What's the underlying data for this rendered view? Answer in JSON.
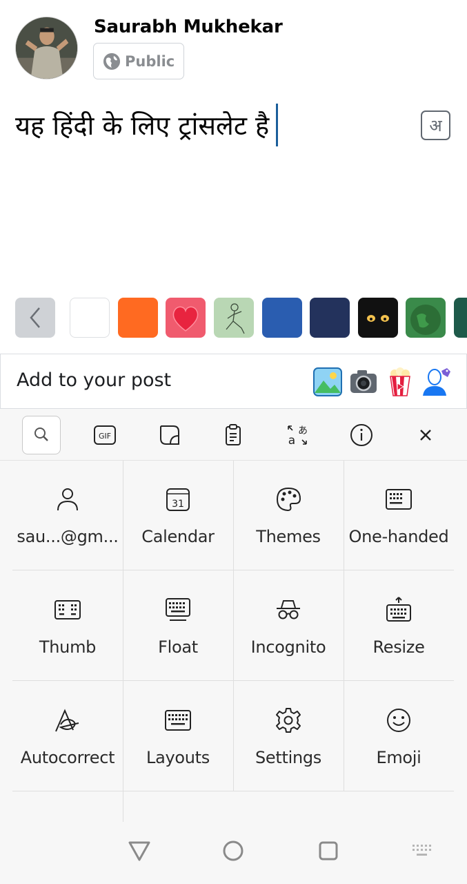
{
  "post": {
    "author_name": "Saurabh Mukhekar",
    "privacy_label": "Public",
    "text": "यह हिंदी के लिए ट्रांसलेट है",
    "transliterate_glyph": "अ"
  },
  "swatches": [
    {
      "name": "white",
      "color": "#ffffff"
    },
    {
      "name": "orange",
      "color": "#ff6a21"
    },
    {
      "name": "heart",
      "color": "#f05b6e"
    },
    {
      "name": "sketch",
      "color": "#b9d7b4"
    },
    {
      "name": "blue",
      "color": "#2a5db0"
    },
    {
      "name": "navy",
      "color": "#23325c"
    },
    {
      "name": "eyes",
      "color": "#111111"
    },
    {
      "name": "globe",
      "color": "#3a8a4a"
    },
    {
      "name": "teal",
      "color": "#1e5a4a"
    }
  ],
  "add_bar": {
    "label": "Add to your post",
    "icons": [
      "photo-icon",
      "camera-icon",
      "popcorn-icon",
      "tag-people-icon"
    ]
  },
  "keyboard": {
    "toolbar": [
      "search-icon",
      "gif-icon",
      "sticker-icon",
      "clipboard-icon",
      "translate-icon",
      "info-icon",
      "close-icon"
    ],
    "gif_label": "GIF",
    "calendar_day": "31",
    "grid": [
      {
        "id": "account",
        "label": "sau...@gm...",
        "icon": "person-icon"
      },
      {
        "id": "calendar",
        "label": "Calendar",
        "icon": "calendar-icon"
      },
      {
        "id": "themes",
        "label": "Themes",
        "icon": "palette-icon"
      },
      {
        "id": "one-handed",
        "label": "One-handed",
        "icon": "keyboard-icon"
      },
      {
        "id": "thumb",
        "label": "Thumb",
        "icon": "split-keyboard-icon"
      },
      {
        "id": "float",
        "label": "Float",
        "icon": "float-keyboard-icon"
      },
      {
        "id": "incognito",
        "label": "Incognito",
        "icon": "incognito-icon"
      },
      {
        "id": "resize",
        "label": "Resize",
        "icon": "resize-keyboard-icon"
      },
      {
        "id": "autocorrect",
        "label": "Autocorrect",
        "icon": "autocorrect-icon"
      },
      {
        "id": "layouts",
        "label": "Layouts",
        "icon": "layout-keyboard-icon"
      },
      {
        "id": "settings",
        "label": "Settings",
        "icon": "gear-icon"
      },
      {
        "id": "emoji",
        "label": "Emoji",
        "icon": "smiley-icon"
      }
    ]
  },
  "navbar": [
    "back-icon",
    "home-icon",
    "recents-icon",
    "keyboard-switch-icon"
  ]
}
